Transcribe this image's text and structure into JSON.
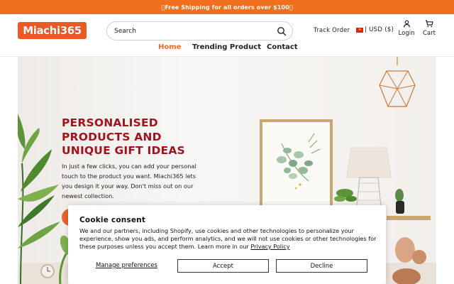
{
  "announcement": {
    "text": "\u0000Free Shipping for all orders over $100\u0000"
  },
  "header": {
    "logo_text": "Miachi365",
    "search": {
      "placeholder": "Search",
      "value": ""
    },
    "track_order": "Track Order",
    "currency": "| USD ($)",
    "login": "Login",
    "cart": "Cart"
  },
  "nav": {
    "items": [
      {
        "label": "Home",
        "active": true
      },
      {
        "label": "Trending Product",
        "active": false
      },
      {
        "label": "Contact",
        "active": false
      }
    ]
  },
  "hero": {
    "title": "PERSONALISED PRODUCTS AND UNIQUE GIFT IDEAS",
    "description": "In just a few clicks, you can add your personal touch to the product you want. Miachi365 lets you design it your way. Don't miss out on our newest collection."
  },
  "cookie": {
    "title": "Cookie consent",
    "body": "We and our partners, including Shopify, use cookies and other technologies to personalize your experience, show you ads, and perform analytics, and we will not use cookies or other technologies for these purposes unless you accept them. Learn more in our",
    "privacy_link": "Privacy Policy",
    "manage": "Manage preferences",
    "accept": "Accept",
    "decline": "Decline"
  },
  "colors": {
    "accent": "#ea6a2b",
    "announcement_bg": "#f06f1e",
    "hero_title": "#a0141e"
  },
  "icons": [
    "search-icon",
    "user-icon",
    "cart-icon",
    "flag-icon"
  ]
}
